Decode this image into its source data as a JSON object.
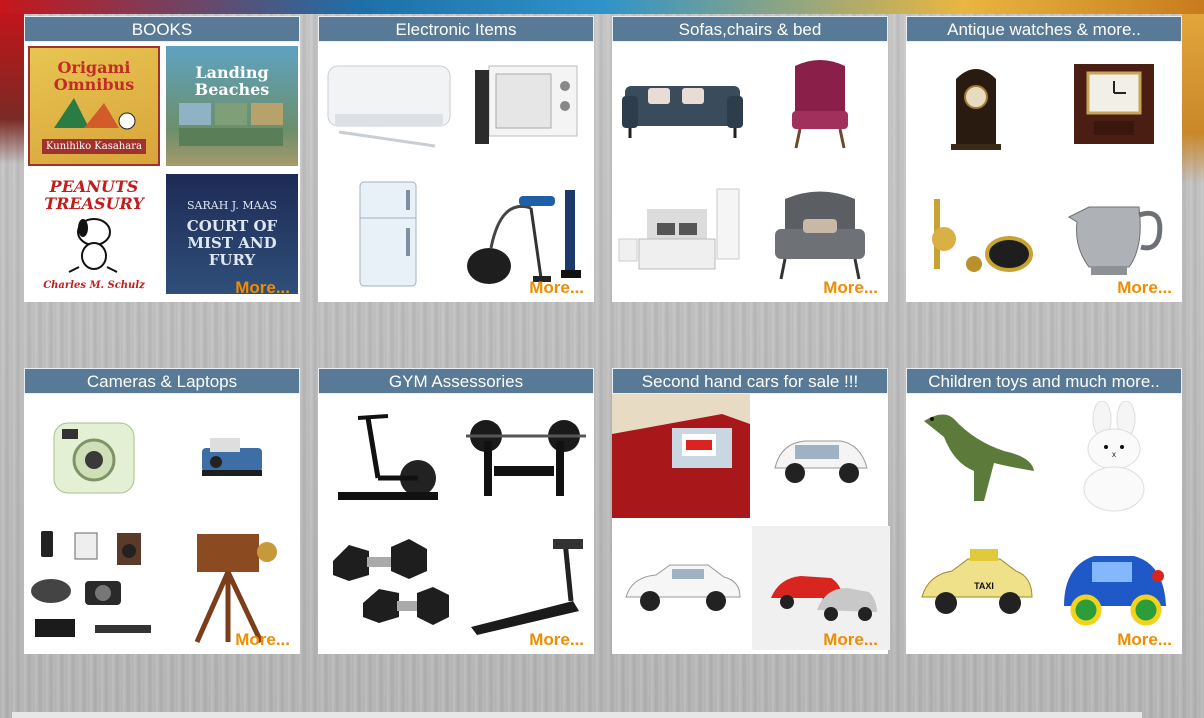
{
  "more_label": "More...",
  "colors": {
    "header_bg": "#587a96",
    "more": "#f08c00",
    "card_bg": "#ffffff"
  },
  "categories": [
    {
      "title": "BOOKS",
      "items": [
        {
          "icon": "book-origami-omnibus-icon",
          "title": "Origami Omnibus",
          "subtitle": "Kunihiko Kasahara"
        },
        {
          "icon": "book-landing-beaches-icon",
          "title": "Landing Beaches"
        },
        {
          "icon": "book-peanuts-treasury-icon",
          "title": "PEANUTS TREASURY",
          "subtitle": "Charles M. Schulz"
        },
        {
          "icon": "book-court-of-mist-and-fury-icon",
          "title": "COURT OF MIST AND FURY",
          "subtitle": "SARAH J. MAAS"
        }
      ]
    },
    {
      "title": "Electronic Items",
      "items": [
        {
          "icon": "air-conditioner-icon"
        },
        {
          "icon": "microwave-oven-icon"
        },
        {
          "icon": "refrigerator-icon"
        },
        {
          "icon": "vacuum-cleaners-icon"
        }
      ]
    },
    {
      "title": "Sofas,chairs & bed",
      "items": [
        {
          "icon": "sofa-icon"
        },
        {
          "icon": "wingback-chair-icon"
        },
        {
          "icon": "bed-icon"
        },
        {
          "icon": "armchair-icon"
        }
      ]
    },
    {
      "title": "Antique watches & more..",
      "items": [
        {
          "icon": "antique-mantel-clock-icon"
        },
        {
          "icon": "wooden-clock-icon"
        },
        {
          "icon": "brass-instruments-icon"
        },
        {
          "icon": "silver-pitcher-icon"
        }
      ]
    },
    {
      "title": "Cameras & Laptops",
      "items": [
        {
          "icon": "instant-camera-icon"
        },
        {
          "icon": "polaroid-camera-icon"
        },
        {
          "icon": "gadgets-collection-icon"
        },
        {
          "icon": "vintage-tripod-camera-icon"
        }
      ]
    },
    {
      "title": "GYM Assessories",
      "items": [
        {
          "icon": "elliptical-trainer-icon"
        },
        {
          "icon": "weight-bench-icon"
        },
        {
          "icon": "dumbbells-icon"
        },
        {
          "icon": "treadmill-icon"
        }
      ]
    },
    {
      "title": "Second hand cars for sale !!!",
      "items": [
        {
          "icon": "red-car-sale-sign-icon"
        },
        {
          "icon": "white-hatchback-icon"
        },
        {
          "icon": "white-sedan-icon"
        },
        {
          "icon": "crashed-cars-icon"
        }
      ]
    },
    {
      "title": "Children toys and much more..",
      "items": [
        {
          "icon": "toy-dinosaur-icon"
        },
        {
          "icon": "plush-bunny-icon"
        },
        {
          "icon": "toy-taxi-icon",
          "label": "TAXI"
        },
        {
          "icon": "toy-car-icon"
        }
      ]
    }
  ]
}
